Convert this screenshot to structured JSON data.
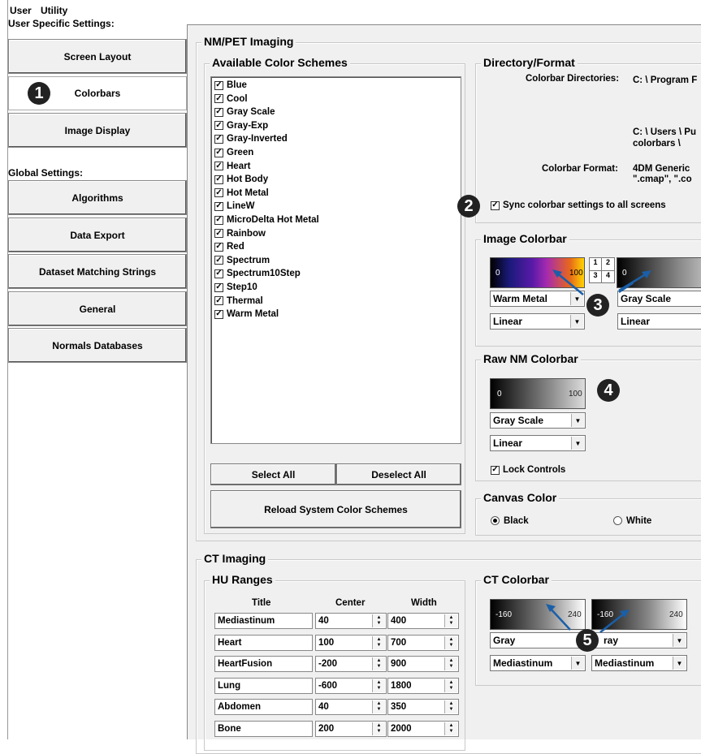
{
  "menu": {
    "items": [
      "User",
      "Utility"
    ]
  },
  "sidebar": {
    "user_section_label": "User Specific Settings:",
    "user_items": [
      {
        "label": "Screen Layout",
        "selected": false
      },
      {
        "label": "Colorbars",
        "selected": true
      },
      {
        "label": "Image Display",
        "selected": false
      }
    ],
    "global_section_label": "Global Settings:",
    "global_items": [
      {
        "label": "Algorithms"
      },
      {
        "label": "Data Export"
      },
      {
        "label": "Dataset Matching Strings"
      },
      {
        "label": "General"
      },
      {
        "label": "Normals Databases"
      }
    ]
  },
  "badges": [
    "1",
    "2",
    "3",
    "4",
    "5"
  ],
  "nmpet": {
    "title": "NM/PET Imaging",
    "available_title": "Available Color Schemes",
    "schemes": [
      "Blue",
      "Cool",
      "Gray Scale",
      "Gray-Exp",
      "Gray-Inverted",
      "Green",
      "Heart",
      "Hot Body",
      "Hot Metal",
      "LineW",
      "MicroDelta Hot Metal",
      "Rainbow",
      "Red",
      "Spectrum",
      "Spectrum10Step",
      "Step10",
      "Thermal",
      "Warm Metal"
    ],
    "select_all": "Select All",
    "deselect_all": "Deselect All",
    "reload": "Reload System Color Schemes",
    "directory": {
      "title": "Directory/Format",
      "dirs_label": "Colorbar Directories:",
      "dir1": "C: \\ Program F",
      "dir2_line1": "C: \\ Users \\ Pu",
      "dir2_line2": "colorbars \\",
      "format_label": "Colorbar Format:",
      "format_line1": "4DM Generic",
      "format_line2": "\".cmap\", \".co",
      "sync_label": "Sync colorbar settings to all screens",
      "sync_checked": true
    },
    "image_colorbar": {
      "title": "Image Colorbar",
      "bar1_min": "0",
      "bar1_max": "100",
      "bar2_min": "0",
      "quad": [
        "1",
        "2",
        "3",
        "4"
      ],
      "scheme1": "Warm Metal",
      "scale1": "Linear",
      "scheme2": "Gray Scale",
      "scale2": "Linear"
    },
    "raw_nm": {
      "title": "Raw NM Colorbar",
      "min": "0",
      "max": "100",
      "scheme": "Gray Scale",
      "scale": "Linear",
      "lock_label": "Lock Controls",
      "lock_checked": true
    },
    "canvas": {
      "title": "Canvas Color",
      "options": [
        "Black",
        "White"
      ],
      "selected": "Black"
    }
  },
  "ct": {
    "title": "CT Imaging",
    "hu_title": "HU Ranges",
    "columns": [
      "Title",
      "Center",
      "Width"
    ],
    "rows": [
      {
        "title": "Mediastinum",
        "center": "40",
        "width": "400"
      },
      {
        "title": "Heart",
        "center": "100",
        "width": "700"
      },
      {
        "title": "HeartFusion",
        "center": "-200",
        "width": "900"
      },
      {
        "title": "Lung",
        "center": "-600",
        "width": "1800"
      },
      {
        "title": "Abdomen",
        "center": "40",
        "width": "350"
      },
      {
        "title": "Bone",
        "center": "200",
        "width": "2000"
      }
    ],
    "colorbar": {
      "title": "CT Colorbar",
      "bar1_min": "-160",
      "bar1_max": "240",
      "bar2_min": "-160",
      "bar2_max": "240",
      "scheme1": "Gray",
      "scheme2": "ray",
      "preset1": "Mediastinum",
      "preset2": "Mediastinum"
    }
  }
}
